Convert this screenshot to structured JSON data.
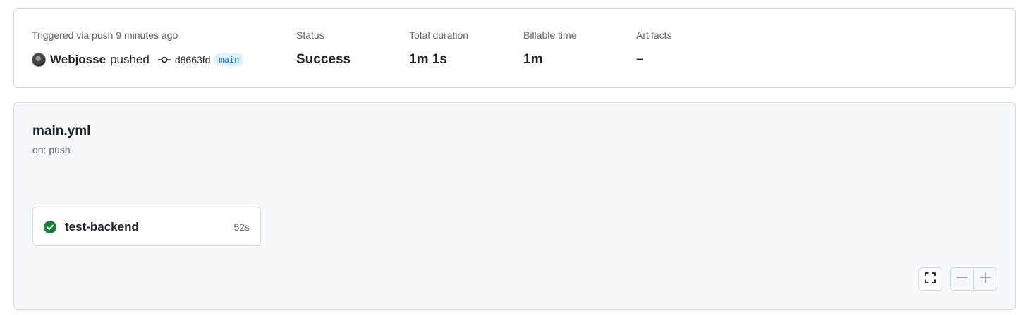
{
  "summary": {
    "trigger_label": "Triggered via push 9 minutes ago",
    "actor": "Webjosse",
    "action": "pushed",
    "commit_sha": "d8663fd",
    "branch": "main",
    "status_label": "Status",
    "status_value": "Success",
    "duration_label": "Total duration",
    "duration_value": "1m 1s",
    "billable_label": "Billable time",
    "billable_value": "1m",
    "artifacts_label": "Artifacts",
    "artifacts_value": "–"
  },
  "workflow": {
    "name": "main.yml",
    "trigger": "on: push",
    "jobs": [
      {
        "name": "test-backend",
        "duration": "52s",
        "status": "success"
      }
    ]
  },
  "controls": {
    "fullscreen_icon": "fullscreen-icon",
    "zoom_out_icon": "minus-icon",
    "zoom_in_icon": "plus-icon"
  },
  "colors": {
    "success": "#1a7f37",
    "link": "#0969da",
    "branch_bg": "#ddf4ff",
    "muted_text": "#59636e",
    "border": "#d1d9e0",
    "canvas_bg": "#f6f8fa"
  }
}
